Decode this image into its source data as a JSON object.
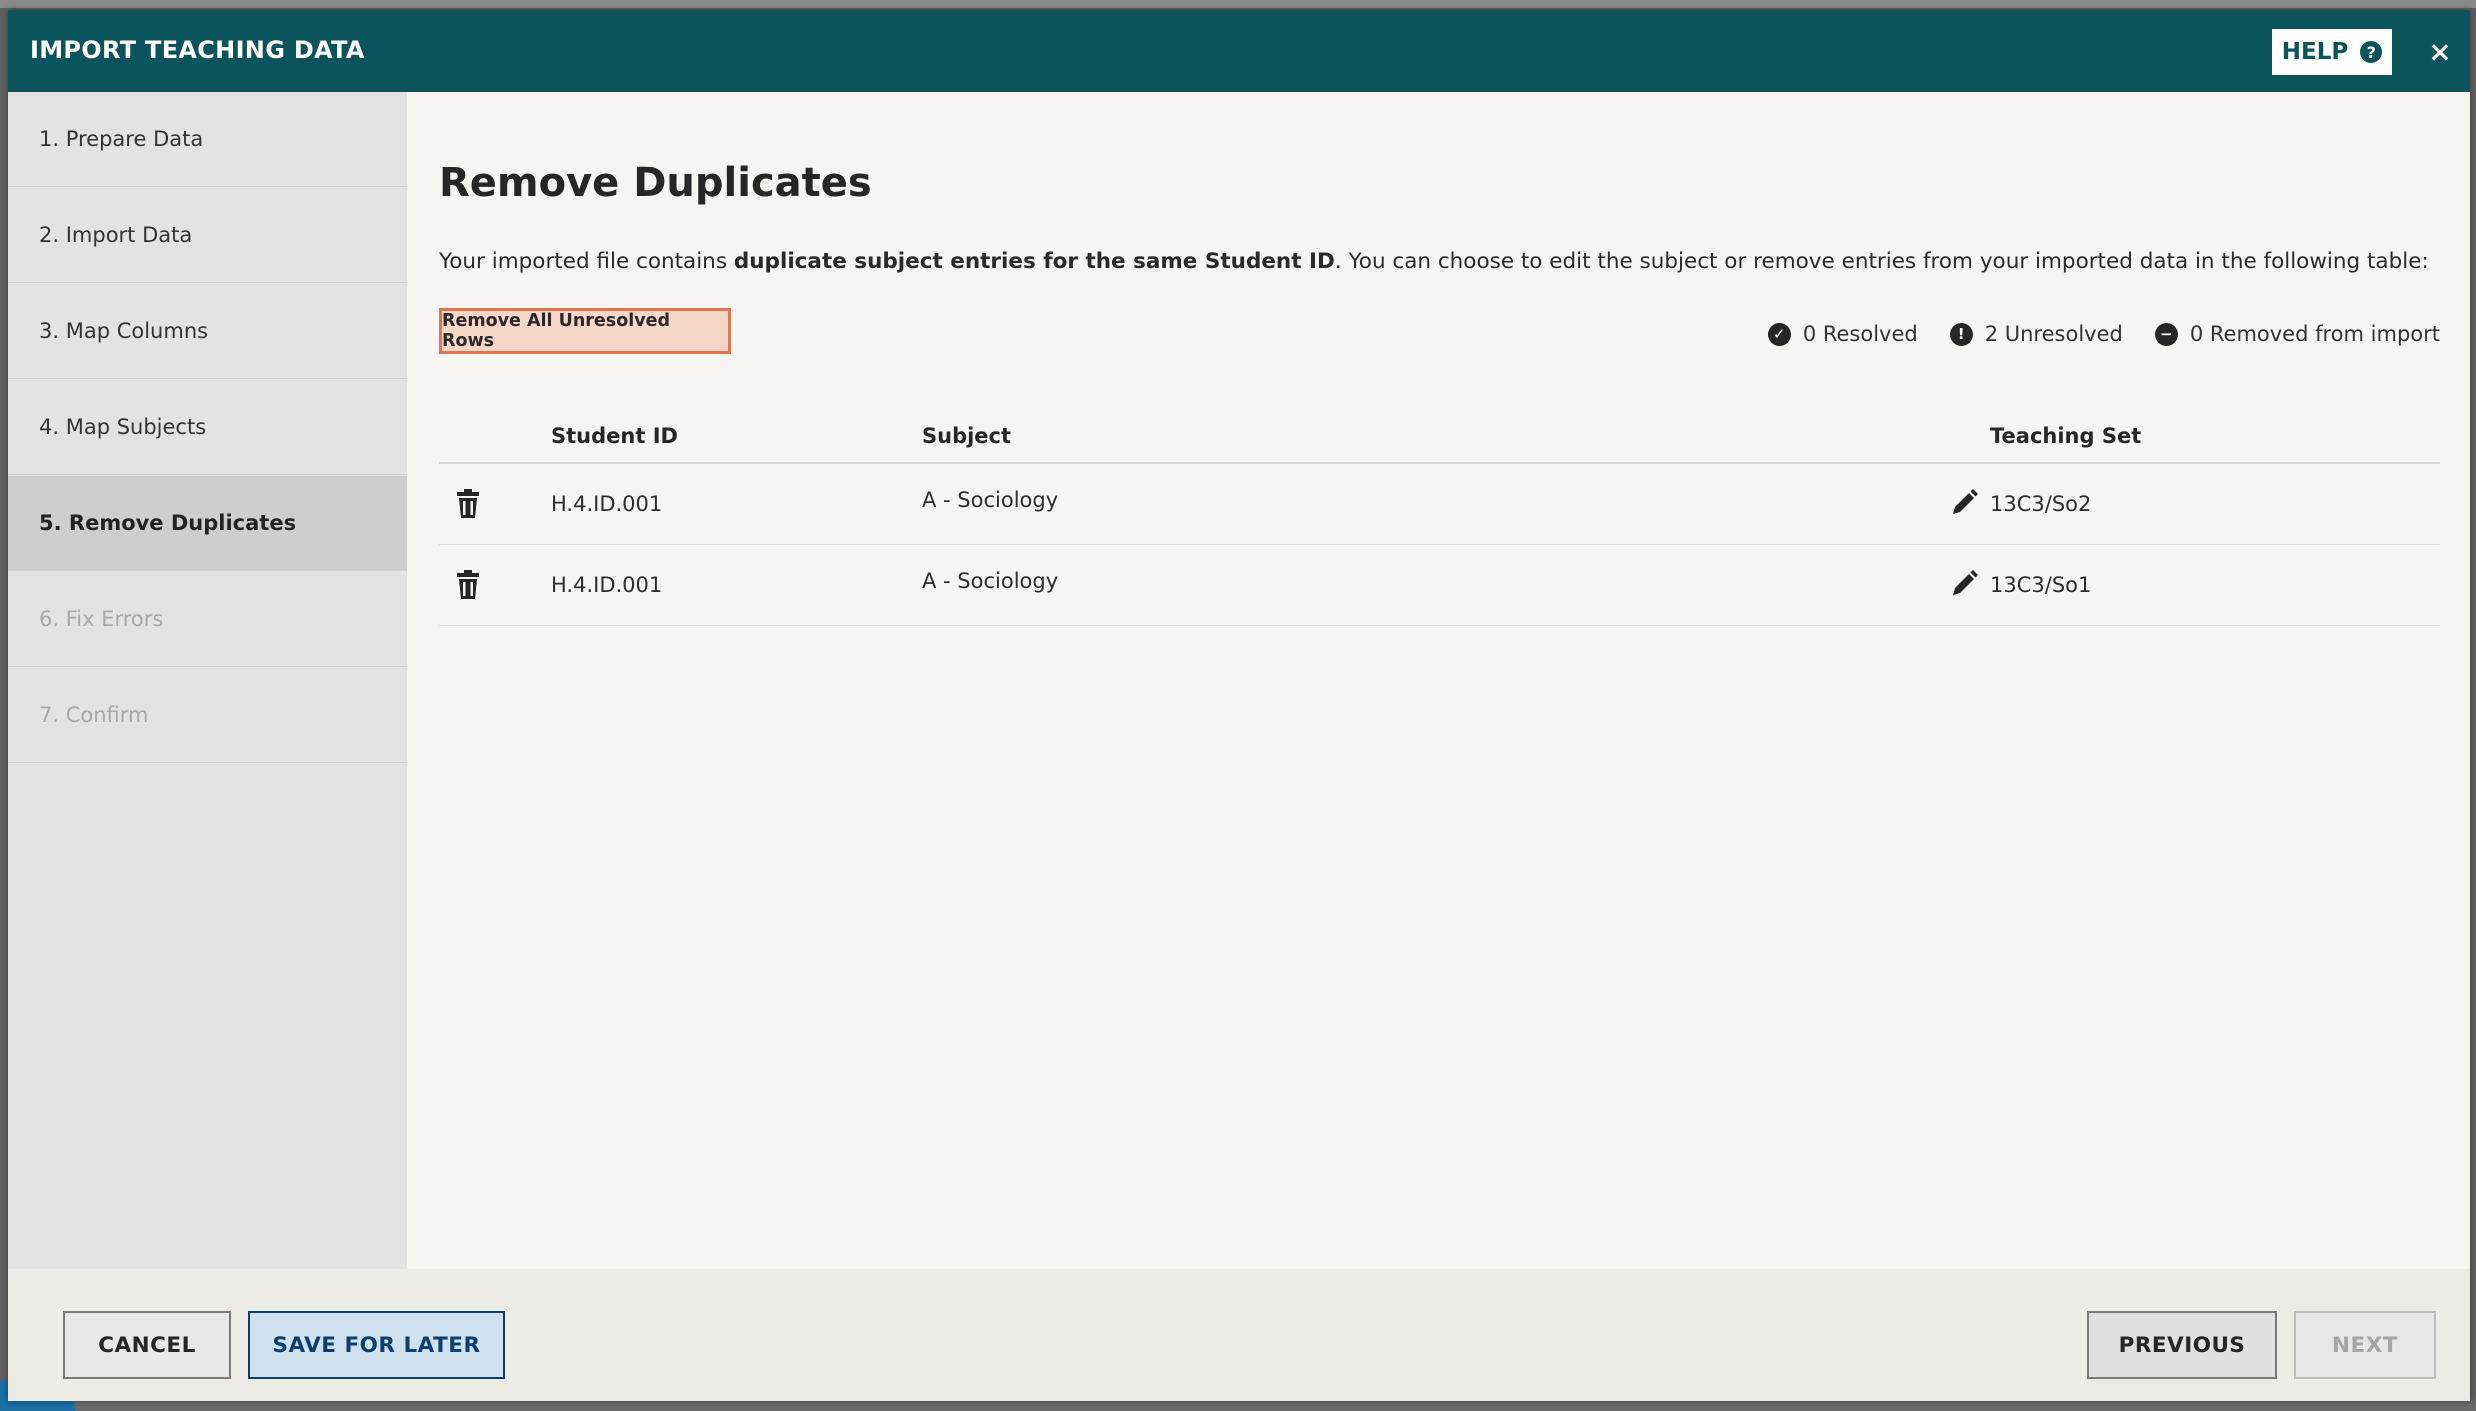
{
  "header": {
    "title": "IMPORT TEACHING DATA",
    "help_label": "HELP",
    "help_icon": "question-circle-icon",
    "close_label": "×"
  },
  "steps": [
    {
      "label": "1. Prepare Data",
      "state": "done"
    },
    {
      "label": "2. Import Data",
      "state": "done"
    },
    {
      "label": "3. Map Columns",
      "state": "done"
    },
    {
      "label": "4. Map Subjects",
      "state": "done"
    },
    {
      "label": "5. Remove Duplicates",
      "state": "active"
    },
    {
      "label": "6. Fix Errors",
      "state": "disabled"
    },
    {
      "label": "7. Confirm",
      "state": "disabled"
    }
  ],
  "main": {
    "title": "Remove Duplicates",
    "description_prefix": "Your imported file contains ",
    "description_bold": "duplicate subject entries for the same Student ID",
    "description_suffix": ". You can choose to edit the subject or remove entries from your imported data in the following table:",
    "remove_all_label": "Remove All Unresolved Rows"
  },
  "status": {
    "resolved": "0 Resolved",
    "unresolved": "2 Unresolved",
    "removed": "0 Removed from import"
  },
  "table": {
    "headers": {
      "student_id": "Student ID",
      "subject": "Subject",
      "teaching_set": "Teaching Set"
    },
    "rows": [
      {
        "student_id": "H.4.ID.001",
        "subject": "A - Sociology",
        "teaching_set": "13C3/So2"
      },
      {
        "student_id": "H.4.ID.001",
        "subject": "A - Sociology",
        "teaching_set": "13C3/So1"
      }
    ]
  },
  "footer": {
    "cancel_label": "CANCEL",
    "save_label": "SAVE FOR LATER",
    "previous_label": "PREVIOUS",
    "next_label": "NEXT"
  },
  "colors": {
    "header_bg": "#0c545c",
    "remove_button_border": "#e07651",
    "remove_button_bg": "#f8d6c8",
    "save_button_border": "#0c3f6b"
  }
}
